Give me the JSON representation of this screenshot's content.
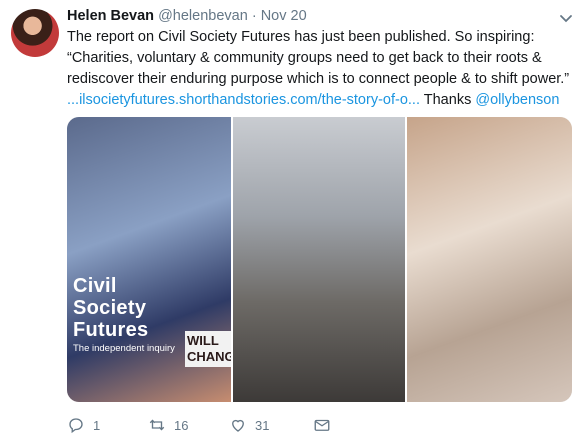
{
  "tweet": {
    "author_name": "Helen Bevan",
    "author_handle": "@helenbevan",
    "separator": "·",
    "timestamp": "Nov 20",
    "text_line1": "The report on Civil Society Futures has just been published. So inspiring:",
    "text_quote": "“Charities, voluntary & community groups need to get back to their roots & rediscover their enduring purpose which is to connect people & to shift power.”",
    "link_text": "...ilsocietyfutures.shorthandstories.com/the-story-of-o...",
    "thanks_text": "Thanks",
    "mention": "@ollybenson"
  },
  "media": {
    "overlay_title_line1": "Civil",
    "overlay_title_line2": "Society",
    "overlay_title_line3": "Futures",
    "overlay_subtitle": "The independent inquiry",
    "sign_text": "WILL CHANG"
  },
  "actions": {
    "reply_count": "1",
    "retweet_count": "16",
    "like_count": "31"
  },
  "icons": [
    "chevron-down-icon",
    "reply-icon",
    "retweet-icon",
    "like-icon",
    "dm-icon"
  ],
  "colors": {
    "link": "#1b95e0",
    "muted": "#657786",
    "text": "#14171a"
  }
}
